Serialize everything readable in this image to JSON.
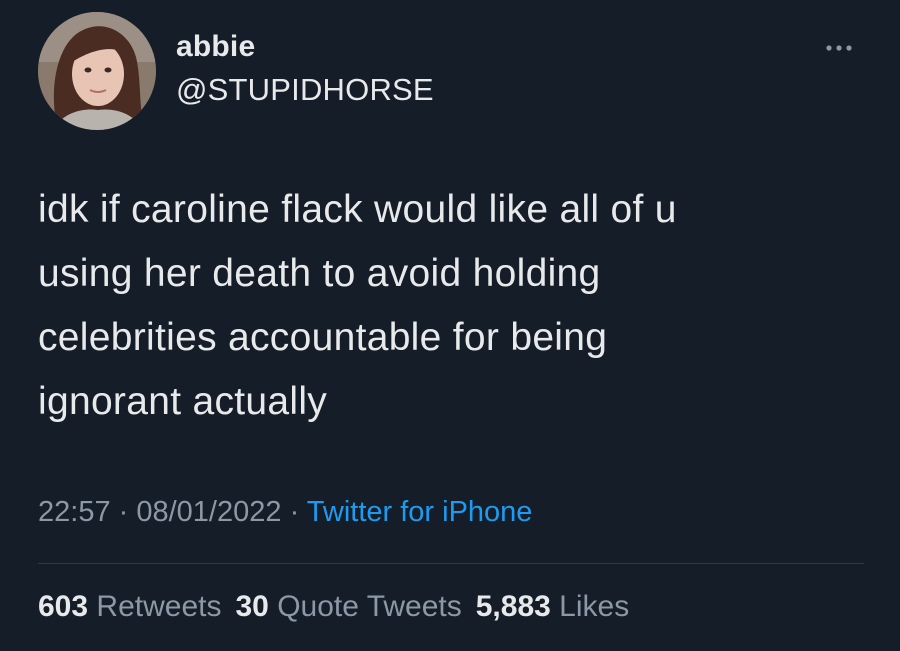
{
  "user": {
    "display_name": "abbie",
    "handle": "@STUPIDHORSE",
    "avatar_icon": "profile-photo"
  },
  "more_icon": "more-dots-icon",
  "tweet": {
    "text": "idk if caroline flack would like all of u\nusing her death to avoid holding\ncelebrities accountable for being\nignorant actually"
  },
  "meta": {
    "time": "22:57",
    "separator": " · ",
    "date": "08/01/2022",
    "source": "Twitter for iPhone"
  },
  "stats": {
    "retweets_count": "603",
    "retweets_label": "Retweets",
    "quotes_count": "30",
    "quotes_label": "Quote Tweets",
    "likes_count": "5,883",
    "likes_label": "Likes"
  },
  "colors": {
    "background": "#151d28",
    "text": "#e7e9ea",
    "secondary": "#8b98a5",
    "link": "#1d9bf0"
  }
}
